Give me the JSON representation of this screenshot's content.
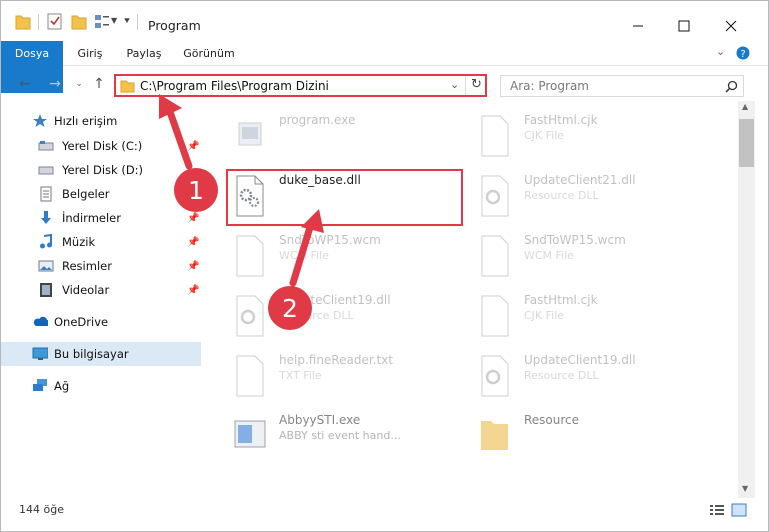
{
  "window": {
    "title": "Program"
  },
  "ribbon": {
    "tabs": [
      "Dosya",
      "Giriş",
      "Paylaş",
      "Görünüm"
    ]
  },
  "address": {
    "path": "C:\\Program Files\\Program Dizini"
  },
  "search": {
    "placeholder": "Ara: Program"
  },
  "sidebar": {
    "items": [
      {
        "label": "Hızlı erişim",
        "icon": "star-icon"
      },
      {
        "label": "Yerel Disk (C:)",
        "icon": "drive-icon"
      },
      {
        "label": "Yerel Disk (D:)",
        "icon": "drive-icon"
      },
      {
        "label": "Belgeler",
        "icon": "documents-icon"
      },
      {
        "label": "İndirmeler",
        "icon": "download-icon"
      },
      {
        "label": "Müzik",
        "icon": "music-icon"
      },
      {
        "label": "Resimler",
        "icon": "pictures-icon"
      },
      {
        "label": "Videolar",
        "icon": "video-icon"
      },
      {
        "label": "OneDrive",
        "icon": "cloud-icon"
      },
      {
        "label": "Bu bilgisayar",
        "icon": "computer-icon"
      },
      {
        "label": "Ağ",
        "icon": "network-icon"
      }
    ]
  },
  "files": [
    {
      "name": "program.exe",
      "type": ""
    },
    {
      "name": "FastHtml.cjk",
      "type": "CJK File"
    },
    {
      "name": "duke_base.dll",
      "type": ""
    },
    {
      "name": "UpdateClient21.dll",
      "type": "Resource DLL"
    },
    {
      "name": "SndToWP15.wcm",
      "type": "WCM File"
    },
    {
      "name": "SndToWP15.wcm",
      "type": "WCM File"
    },
    {
      "name": "UpdateClient19.dll",
      "type": "Resource DLL"
    },
    {
      "name": "FastHtml.cjk",
      "type": "CJK File"
    },
    {
      "name": "help.fineReader.txt",
      "type": "TXT File"
    },
    {
      "name": "UpdateClient19.dll",
      "type": "Resource DLL"
    },
    {
      "name": "AbbyySTI.exe",
      "type": "ABBY sti event hand..."
    },
    {
      "name": "Resource",
      "type": ""
    }
  ],
  "annotations": {
    "step1": "1",
    "step2": "2"
  },
  "status": {
    "count": "144 öğe"
  },
  "colors": {
    "accent": "#1979ca",
    "highlight": "#e03a47"
  }
}
